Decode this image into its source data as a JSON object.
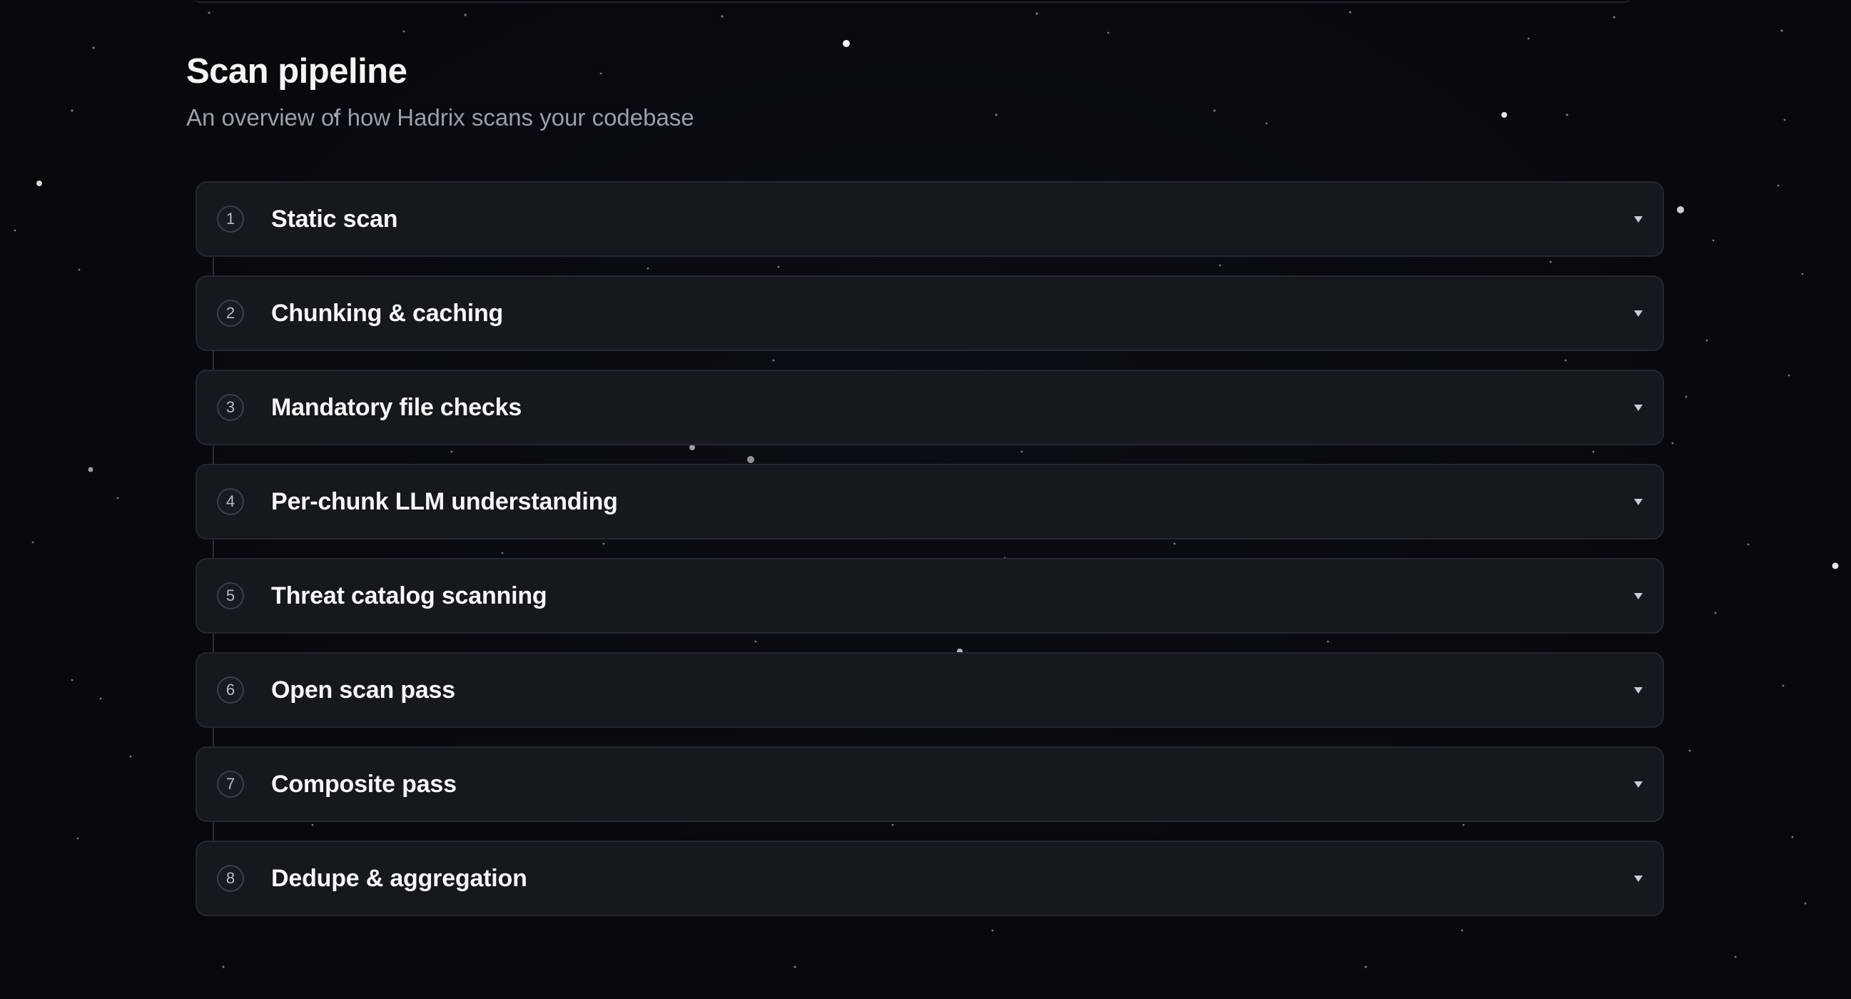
{
  "header": {
    "title": "Scan pipeline",
    "subtitle": "An overview of how Hadrix scans your codebase"
  },
  "steps": [
    {
      "number": "1",
      "title": "Static scan",
      "icon": "chevron-down-icon"
    },
    {
      "number": "2",
      "title": "Chunking & caching",
      "icon": "chevron-down-icon"
    },
    {
      "number": "3",
      "title": "Mandatory file checks",
      "icon": "chevron-down-icon"
    },
    {
      "number": "4",
      "title": "Per-chunk LLM understanding",
      "icon": "chevron-down-icon"
    },
    {
      "number": "5",
      "title": "Threat catalog scanning",
      "icon": "chevron-down-icon"
    },
    {
      "number": "6",
      "title": "Open scan pass",
      "icon": "chevron-down-icon"
    },
    {
      "number": "7",
      "title": "Composite pass",
      "icon": "chevron-down-icon"
    },
    {
      "number": "8",
      "title": "Dedupe & aggregation",
      "icon": "chevron-down-icon"
    }
  ],
  "colors": {
    "background": "#07090d",
    "card": "#15181d",
    "card_border": "#23272e",
    "title": "#f3f4f6",
    "subtitle": "#9aa0aa"
  }
}
